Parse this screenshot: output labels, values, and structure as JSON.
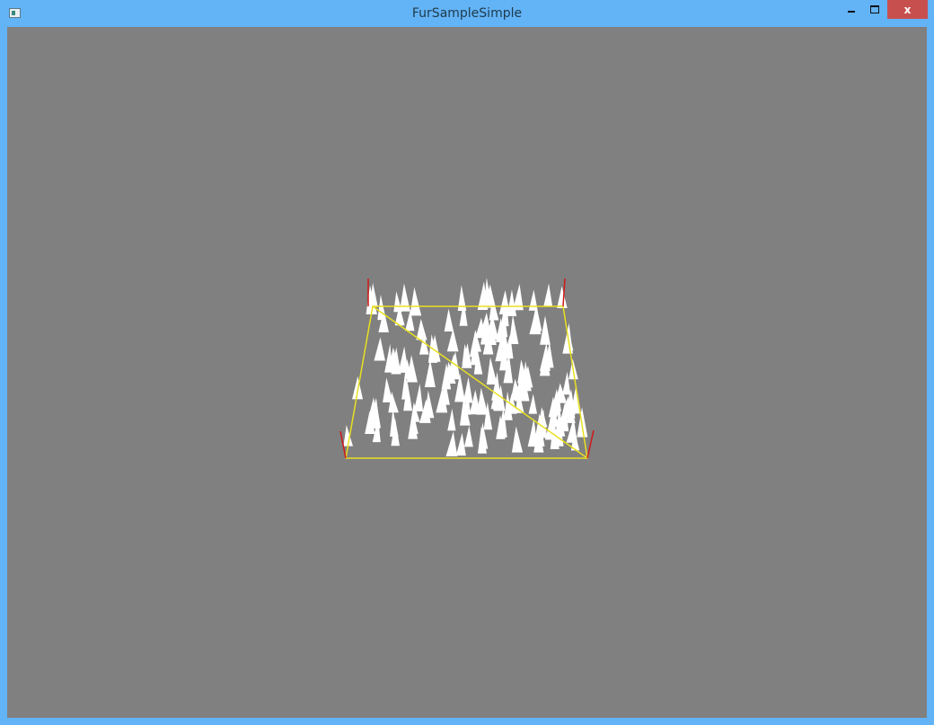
{
  "window": {
    "title": "FurSampleSimple",
    "close_label": "x",
    "icons": {
      "app": "app-icon",
      "minimize": "minimize-icon",
      "maximize": "maximize-icon",
      "close": "close-icon"
    }
  },
  "scene": {
    "background": "#808080",
    "outline_color": "#e8e020",
    "normal_color": "#d01818",
    "fur_color": "#ffffff"
  }
}
